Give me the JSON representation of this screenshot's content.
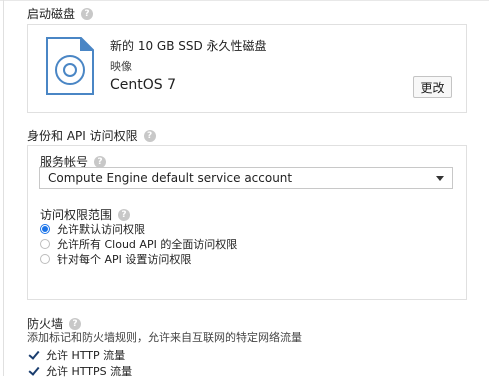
{
  "boot_disk": {
    "title": "启动磁盘",
    "disk_name": "新的 10 GB SSD 永久性磁盘",
    "image_label": "映像",
    "image_value": "CentOS 7",
    "change_button": "更改"
  },
  "identity": {
    "title": "身份和 API 访问权限",
    "service_account_label": "服务帐号",
    "service_account_value": "Compute Engine default service account",
    "access_scope_label": "访问权限范围",
    "scopes": [
      {
        "label": "允许默认访问权限",
        "selected": true
      },
      {
        "label": "允许所有 Cloud API 的全面访问权限",
        "selected": false
      },
      {
        "label": "针对每个 API 设置访问权限",
        "selected": false
      }
    ]
  },
  "firewall": {
    "title": "防火墙",
    "description": "添加标记和防火墙规则，允许来自互联网的特定网络流量",
    "options": [
      {
        "label": "允许 HTTP 流量",
        "checked": true
      },
      {
        "label": "允许 HTTPS 流量",
        "checked": true
      }
    ]
  },
  "colors": {
    "accent": "#1a73e8",
    "icon_blue": "#4a86c5",
    "border": "#e0e0e0"
  }
}
